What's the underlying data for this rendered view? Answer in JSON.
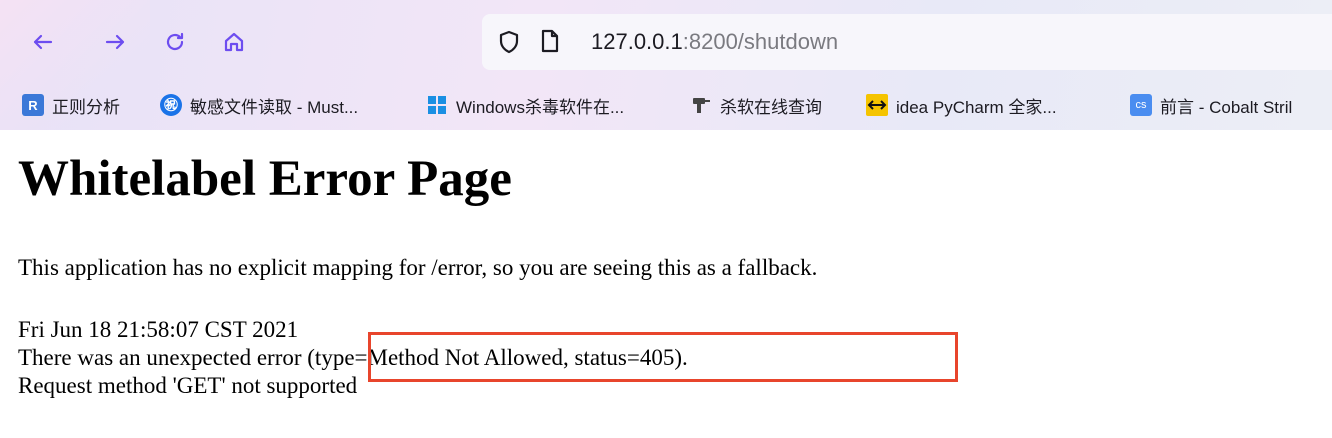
{
  "browser": {
    "nav": {
      "back_icon": "arrow-left-icon",
      "forward_icon": "arrow-right-icon",
      "reload_icon": "reload-icon",
      "home_icon": "home-icon"
    },
    "url": {
      "host": "127.0.0.1",
      "rest": ":8200/shutdown"
    },
    "accent_color": "#6d4df0",
    "bookmarks": [
      {
        "label": "正则分析",
        "icon": "R",
        "icon_color": "#3b78d8"
      },
      {
        "label": "敏感文件读取 - Must...",
        "icon": "㊗",
        "icon_color": "#1a73e8"
      },
      {
        "label": "Windows杀毒软件在...",
        "icon": "windows-logo-icon",
        "icon_color": "#1a8fe3"
      },
      {
        "label": "杀软在线查询",
        "icon": "drill-icon",
        "icon_color": "#444444"
      },
      {
        "label": "idea PyCharm 全家...",
        "icon": "arrows-icon",
        "icon_color": "#f5c400"
      },
      {
        "label": "前言 - Cobalt Stril",
        "icon": "cs",
        "icon_color": "#4a8df0"
      }
    ]
  },
  "page": {
    "title": "Whitelabel Error Page",
    "message": "This application has no explicit mapping for /error, so you are seeing this as a fallback.",
    "timestamp": "Fri Jun 18 21:58:07 CST 2021",
    "error_line": "There was an unexpected error (type=Method Not Allowed, status=405).",
    "detail": "Request method 'GET' not supported",
    "highlight_color": "#e8452c"
  }
}
